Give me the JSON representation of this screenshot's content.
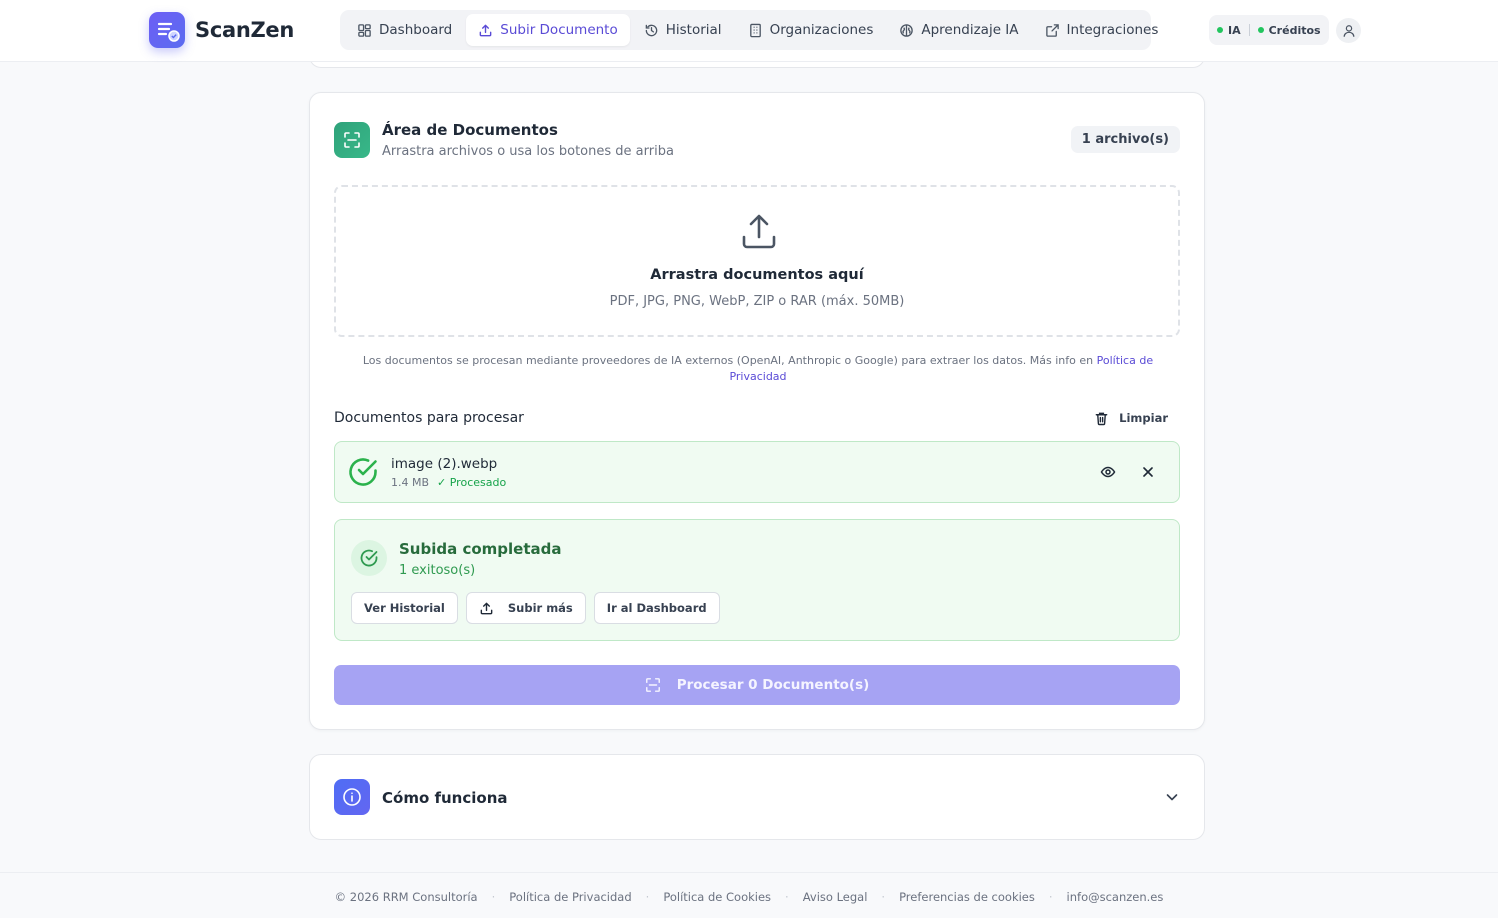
{
  "app": {
    "name": "ScanZen"
  },
  "nav": {
    "items": [
      {
        "label": "Dashboard",
        "icon": "grid-icon"
      },
      {
        "label": "Subir Documento",
        "icon": "upload-icon",
        "active": true
      },
      {
        "label": "Historial",
        "icon": "history-icon"
      },
      {
        "label": "Organizaciones",
        "icon": "building-icon"
      },
      {
        "label": "Aprendizaje IA",
        "icon": "brain-icon"
      },
      {
        "label": "Integraciones",
        "icon": "external-link-icon"
      }
    ]
  },
  "status": {
    "ia_label": "IA",
    "credits_label": "Créditos",
    "ok_color": "#22c55e"
  },
  "upload_card": {
    "title": "Área de Documentos",
    "subtitle": "Arrastra archivos o usa los botones de arriba",
    "file_count": "1 archivo(s)",
    "dropzone": {
      "title": "Arrastra documentos aquí",
      "formats": "PDF, JPG, PNG, WebP, ZIP o RAR (máx. 50MB)"
    },
    "privacy": {
      "text": "Los documentos se procesan mediante proveedores de IA externos (OpenAI, Anthropic o Google) para extraer los datos. Más info en ",
      "link": "Política de Privacidad"
    },
    "list_title": "Documentos para procesar",
    "clear_label": "Limpiar",
    "files": [
      {
        "name": "image (2).webp",
        "size": "1.4 MB",
        "status": "✓ Procesado"
      }
    ],
    "result": {
      "title": "Subida completada",
      "subtitle": "1 exitoso(s)",
      "buttons": {
        "history": "Ver Historial",
        "upload_more": "Subir más",
        "dashboard": "Ir al Dashboard"
      }
    },
    "process_button": "Procesar 0 Documento(s)",
    "accent_color": "#5a4bd6",
    "success_color": "#16a34a"
  },
  "how_it_works": {
    "title": "Cómo funciona"
  },
  "footer": {
    "copyright": "© 2026 RRM Consultoría",
    "links": [
      "Política de Privacidad",
      "Política de Cookies",
      "Aviso Legal",
      "Preferencias de cookies",
      "info@scanzen.es"
    ],
    "separator": "·"
  }
}
